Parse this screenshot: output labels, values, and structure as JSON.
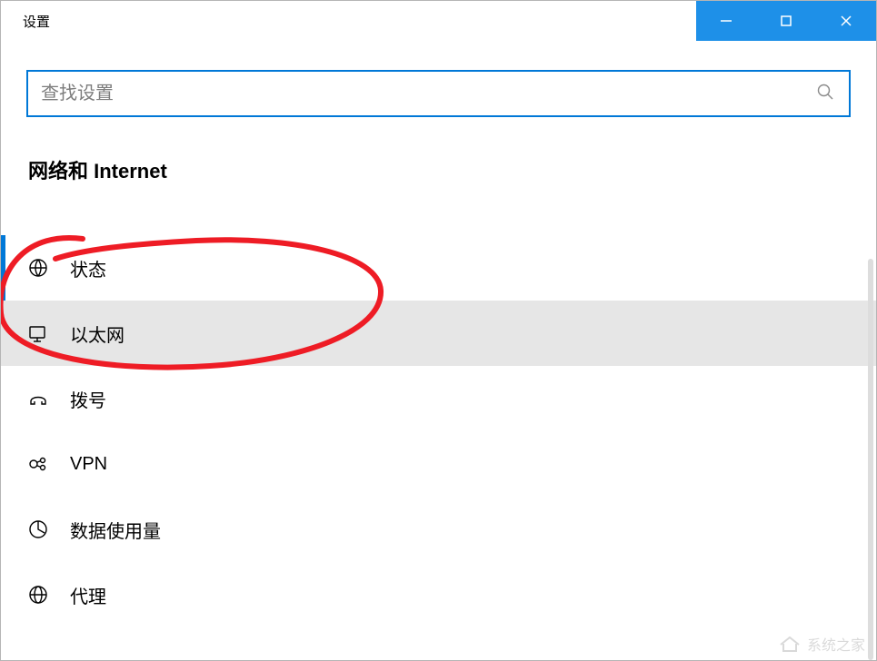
{
  "titlebar": {
    "title": "设置"
  },
  "search": {
    "placeholder": "查找设置",
    "value": ""
  },
  "section": {
    "title": "网络和 Internet"
  },
  "nav": {
    "items": [
      {
        "label": "状态",
        "icon": "status-icon",
        "active": true,
        "selected": false
      },
      {
        "label": "以太网",
        "icon": "ethernet-icon",
        "active": false,
        "selected": true
      },
      {
        "label": "拨号",
        "icon": "dialup-icon",
        "active": false,
        "selected": false
      },
      {
        "label": "VPN",
        "icon": "vpn-icon",
        "active": false,
        "selected": false
      },
      {
        "label": "数据使用量",
        "icon": "data-icon",
        "active": false,
        "selected": false
      },
      {
        "label": "代理",
        "icon": "proxy-icon",
        "active": false,
        "selected": false
      }
    ]
  },
  "annotation": {
    "stroke": "#ee1c25",
    "circled_item_index": 1
  },
  "watermark": {
    "text": "系统之家"
  }
}
